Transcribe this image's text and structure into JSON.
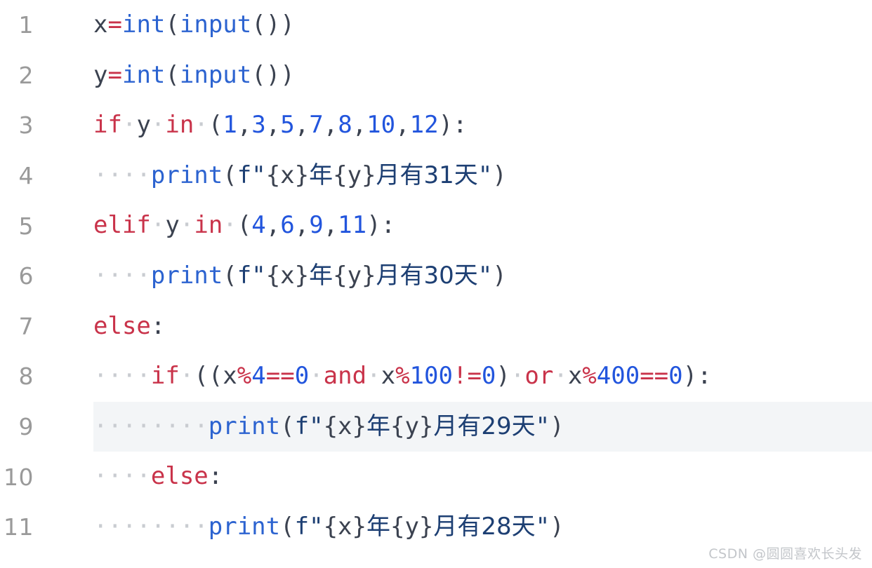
{
  "editor": {
    "language": "python",
    "indent_dot": "·",
    "colors": {
      "background": "#ffffff",
      "line_number": "#9a9a9a",
      "highlight_row": "#f3f5f7",
      "plain": "#3b4250",
      "keyword": "#c9334a",
      "operator": "#c9334a",
      "builtin": "#2c63d0",
      "number": "#2255dd",
      "string": "#1d3f73",
      "indent_guide": "#c9ccd1",
      "watermark": "#c3c6ca"
    },
    "highlighted_line": 9,
    "lines": [
      {
        "number": "1",
        "text": "x=int(input())",
        "tokens": [
          {
            "t": "x",
            "c": "plain"
          },
          {
            "t": "=",
            "c": "operator"
          },
          {
            "t": "int",
            "c": "builtin"
          },
          {
            "t": "(",
            "c": "punct"
          },
          {
            "t": "input",
            "c": "builtin"
          },
          {
            "t": "(",
            "c": "punct"
          },
          {
            "t": ")",
            "c": "punct"
          },
          {
            "t": ")",
            "c": "punct"
          }
        ]
      },
      {
        "number": "2",
        "text": "y=int(input())",
        "tokens": [
          {
            "t": "y",
            "c": "plain"
          },
          {
            "t": "=",
            "c": "operator"
          },
          {
            "t": "int",
            "c": "builtin"
          },
          {
            "t": "(",
            "c": "punct"
          },
          {
            "t": "input",
            "c": "builtin"
          },
          {
            "t": "(",
            "c": "punct"
          },
          {
            "t": ")",
            "c": "punct"
          },
          {
            "t": ")",
            "c": "punct"
          }
        ]
      },
      {
        "number": "3",
        "text": "if y in (1,3,5,7,8,10,12):",
        "tokens": [
          {
            "t": "if",
            "c": "keyword"
          },
          {
            "t": "·",
            "c": "indent"
          },
          {
            "t": "y",
            "c": "plain"
          },
          {
            "t": "·",
            "c": "indent"
          },
          {
            "t": "in",
            "c": "keyword"
          },
          {
            "t": "·",
            "c": "indent"
          },
          {
            "t": "(",
            "c": "punct"
          },
          {
            "t": "1",
            "c": "number"
          },
          {
            "t": ",",
            "c": "punct"
          },
          {
            "t": "3",
            "c": "number"
          },
          {
            "t": ",",
            "c": "punct"
          },
          {
            "t": "5",
            "c": "number"
          },
          {
            "t": ",",
            "c": "punct"
          },
          {
            "t": "7",
            "c": "number"
          },
          {
            "t": ",",
            "c": "punct"
          },
          {
            "t": "8",
            "c": "number"
          },
          {
            "t": ",",
            "c": "punct"
          },
          {
            "t": "10",
            "c": "number"
          },
          {
            "t": ",",
            "c": "punct"
          },
          {
            "t": "12",
            "c": "number"
          },
          {
            "t": ")",
            "c": "punct"
          },
          {
            "t": ":",
            "c": "punct"
          }
        ]
      },
      {
        "number": "4",
        "text": "    print(f\"{x}年{y}月有31天\")",
        "tokens": [
          {
            "t": "····",
            "c": "indent"
          },
          {
            "t": "print",
            "c": "builtin"
          },
          {
            "t": "(",
            "c": "punct"
          },
          {
            "t": "f\"",
            "c": "string"
          },
          {
            "t": "{x}",
            "c": "interp"
          },
          {
            "t": "年",
            "c": "string"
          },
          {
            "t": "{y}",
            "c": "interp"
          },
          {
            "t": "月有31天",
            "c": "string"
          },
          {
            "t": "\"",
            "c": "string"
          },
          {
            "t": ")",
            "c": "punct"
          }
        ]
      },
      {
        "number": "5",
        "text": "elif y in (4,6,9,11):",
        "tokens": [
          {
            "t": "elif",
            "c": "keyword"
          },
          {
            "t": "·",
            "c": "indent"
          },
          {
            "t": "y",
            "c": "plain"
          },
          {
            "t": "·",
            "c": "indent"
          },
          {
            "t": "in",
            "c": "keyword"
          },
          {
            "t": "·",
            "c": "indent"
          },
          {
            "t": "(",
            "c": "punct"
          },
          {
            "t": "4",
            "c": "number"
          },
          {
            "t": ",",
            "c": "punct"
          },
          {
            "t": "6",
            "c": "number"
          },
          {
            "t": ",",
            "c": "punct"
          },
          {
            "t": "9",
            "c": "number"
          },
          {
            "t": ",",
            "c": "punct"
          },
          {
            "t": "11",
            "c": "number"
          },
          {
            "t": ")",
            "c": "punct"
          },
          {
            "t": ":",
            "c": "punct"
          }
        ]
      },
      {
        "number": "6",
        "text": "    print(f\"{x}年{y}月有30天\")",
        "tokens": [
          {
            "t": "····",
            "c": "indent"
          },
          {
            "t": "print",
            "c": "builtin"
          },
          {
            "t": "(",
            "c": "punct"
          },
          {
            "t": "f\"",
            "c": "string"
          },
          {
            "t": "{x}",
            "c": "interp"
          },
          {
            "t": "年",
            "c": "string"
          },
          {
            "t": "{y}",
            "c": "interp"
          },
          {
            "t": "月有30天",
            "c": "string"
          },
          {
            "t": "\"",
            "c": "string"
          },
          {
            "t": ")",
            "c": "punct"
          }
        ]
      },
      {
        "number": "7",
        "text": "else:",
        "tokens": [
          {
            "t": "else",
            "c": "keyword"
          },
          {
            "t": ":",
            "c": "punct"
          }
        ]
      },
      {
        "number": "8",
        "text": "    if ((x%4==0 and x%100!=0) or x%400==0):",
        "tokens": [
          {
            "t": "····",
            "c": "indent"
          },
          {
            "t": "if",
            "c": "keyword"
          },
          {
            "t": "·",
            "c": "indent"
          },
          {
            "t": "(",
            "c": "punct"
          },
          {
            "t": "(",
            "c": "punct"
          },
          {
            "t": "x",
            "c": "plain"
          },
          {
            "t": "%",
            "c": "operator"
          },
          {
            "t": "4",
            "c": "number"
          },
          {
            "t": "==",
            "c": "operator"
          },
          {
            "t": "0",
            "c": "number"
          },
          {
            "t": "·",
            "c": "indent"
          },
          {
            "t": "and",
            "c": "keyword"
          },
          {
            "t": "·",
            "c": "indent"
          },
          {
            "t": "x",
            "c": "plain"
          },
          {
            "t": "%",
            "c": "operator"
          },
          {
            "t": "100",
            "c": "number"
          },
          {
            "t": "!=",
            "c": "operator"
          },
          {
            "t": "0",
            "c": "number"
          },
          {
            "t": ")",
            "c": "punct"
          },
          {
            "t": "·",
            "c": "indent"
          },
          {
            "t": "or",
            "c": "keyword"
          },
          {
            "t": "·",
            "c": "indent"
          },
          {
            "t": "x",
            "c": "plain"
          },
          {
            "t": "%",
            "c": "operator"
          },
          {
            "t": "400",
            "c": "number"
          },
          {
            "t": "==",
            "c": "operator"
          },
          {
            "t": "0",
            "c": "number"
          },
          {
            "t": ")",
            "c": "punct"
          },
          {
            "t": ":",
            "c": "punct"
          }
        ]
      },
      {
        "number": "9",
        "text": "        print(f\"{x}年{y}月有29天\")",
        "highlighted": true,
        "tokens": [
          {
            "t": "········",
            "c": "indent"
          },
          {
            "t": "print",
            "c": "builtin"
          },
          {
            "t": "(",
            "c": "punct"
          },
          {
            "t": "f\"",
            "c": "string"
          },
          {
            "t": "{x}",
            "c": "interp"
          },
          {
            "t": "年",
            "c": "string"
          },
          {
            "t": "{y}",
            "c": "interp"
          },
          {
            "t": "月有29天",
            "c": "string"
          },
          {
            "t": "\"",
            "c": "string"
          },
          {
            "t": ")",
            "c": "punct"
          }
        ]
      },
      {
        "number": "10",
        "text": "    else:",
        "tokens": [
          {
            "t": "····",
            "c": "indent"
          },
          {
            "t": "else",
            "c": "keyword"
          },
          {
            "t": ":",
            "c": "punct"
          }
        ]
      },
      {
        "number": "11",
        "text": "        print(f\"{x}年{y}月有28天\")",
        "tokens": [
          {
            "t": "········",
            "c": "indent"
          },
          {
            "t": "print",
            "c": "builtin"
          },
          {
            "t": "(",
            "c": "punct"
          },
          {
            "t": "f\"",
            "c": "string"
          },
          {
            "t": "{x}",
            "c": "interp"
          },
          {
            "t": "年",
            "c": "string"
          },
          {
            "t": "{y}",
            "c": "interp"
          },
          {
            "t": "月有28天",
            "c": "string"
          },
          {
            "t": "\"",
            "c": "string"
          },
          {
            "t": ")",
            "c": "punct"
          }
        ]
      }
    ]
  },
  "watermark": {
    "text": "CSDN @圆圆喜欢长头发"
  }
}
